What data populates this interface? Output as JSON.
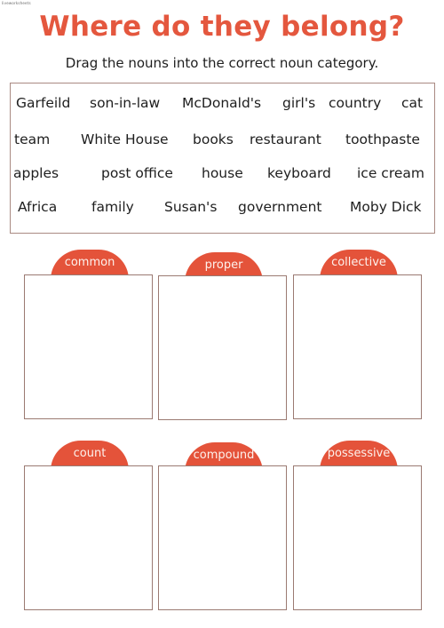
{
  "watermark": "liveworksheets",
  "header": {
    "title": "Where do they belong?",
    "instruction": "Drag the nouns into the correct noun category."
  },
  "word_bank": {
    "rows": [
      [
        "Garfeild",
        "son-in-law",
        "McDonald's",
        "girl's",
        "country",
        "cat"
      ],
      [
        "team",
        "White House",
        "books",
        "restaurant",
        "toothpaste"
      ],
      [
        "apples",
        "post office",
        "house",
        "keyboard",
        "ice cream"
      ],
      [
        "Africa",
        "family",
        "Susan's",
        "government",
        "Moby Dick"
      ]
    ]
  },
  "categories": [
    {
      "label": "common"
    },
    {
      "label": "proper"
    },
    {
      "label": "collective"
    },
    {
      "label": "count"
    },
    {
      "label": "compound"
    },
    {
      "label": "possessive"
    }
  ],
  "colors": {
    "accent": "#e4533a",
    "title": "#e4573e",
    "box_border": "#9b7a72"
  }
}
